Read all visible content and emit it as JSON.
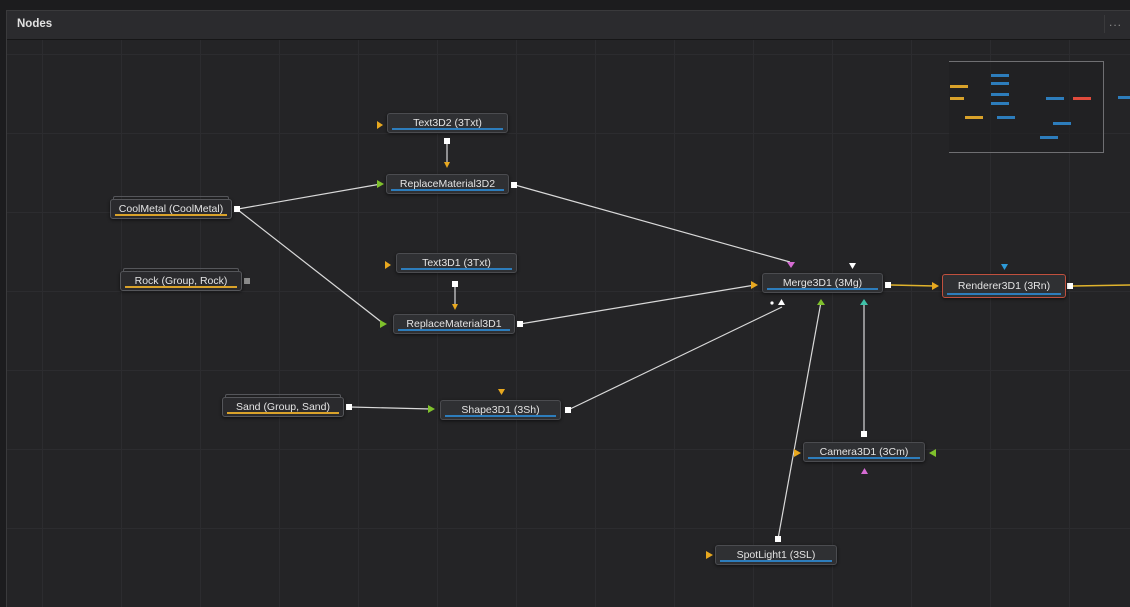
{
  "panel": {
    "title": "Nodes",
    "menu_label": "..."
  },
  "nodes": {
    "text3d2": "Text3D2  (3Txt)",
    "replace_material_3d2": "ReplaceMaterial3D2",
    "cool_metal": "CoolMetal  (CoolMetal)",
    "rock": "Rock  (Group, Rock)",
    "text3d1": "Text3D1  (3Txt)",
    "replace_material_3d1": "ReplaceMaterial3D1",
    "merge3d1": "Merge3D1  (3Mg)",
    "renderer3d1": "Renderer3D1  (3Rn)",
    "sand": "Sand  (Group, Sand)",
    "shape3d1": "Shape3D1  (3Sh)",
    "camera3d1": "Camera3D1  (3Cm)",
    "spotlight1": "SpotLight1  (3SL)"
  },
  "colors": {
    "link": "#d9d9d9",
    "output_link": "#e0b32c",
    "input_orange": "#e8a81f",
    "input_green": "#7fc12c",
    "input_pink": "#d66bd3",
    "input_cyan": "#3fc1a8",
    "input_blue": "#2d9ad9",
    "node_bar_blue": "#2d7dbc",
    "group_bar_gold": "#d9a22a",
    "selected_border": "#c0503e"
  }
}
